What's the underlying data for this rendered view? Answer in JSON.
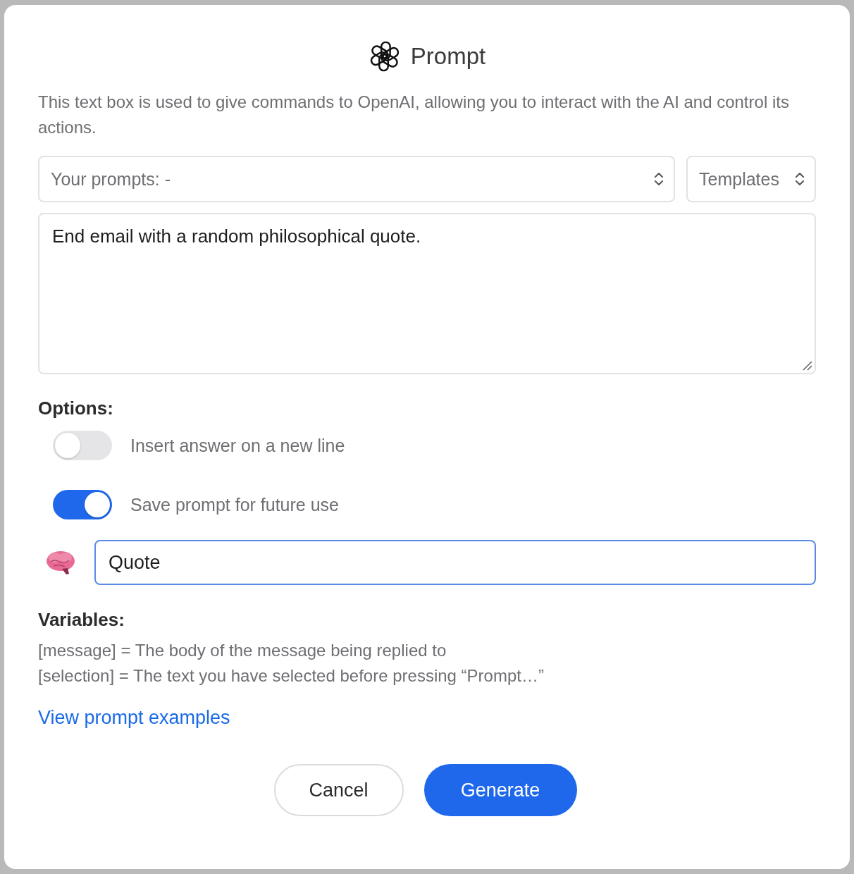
{
  "dialog": {
    "title": "Prompt",
    "description": "This text box is used to give commands to OpenAI, allowing you to interact with the AI and control its actions.",
    "prompt_select": {
      "value": "Your prompts: -"
    },
    "templates_select": {
      "value": "Templates"
    },
    "prompt_text": {
      "value": "End email with a random philosophical quote."
    },
    "options_heading": "Options:",
    "options": [
      {
        "label": "Insert answer on a new line",
        "on": false
      },
      {
        "label": "Save prompt for future use",
        "on": true
      }
    ],
    "prompt_name": {
      "value": "Quote"
    },
    "variables_heading": "Variables:",
    "variables": [
      "[message] = The body of the message being replied to",
      "[selection] = The text you have selected before pressing “Prompt…”"
    ],
    "examples_link": "View prompt examples",
    "buttons": [
      {
        "label": "Cancel",
        "kind": "secondary"
      },
      {
        "label": "Generate",
        "kind": "primary"
      }
    ]
  }
}
